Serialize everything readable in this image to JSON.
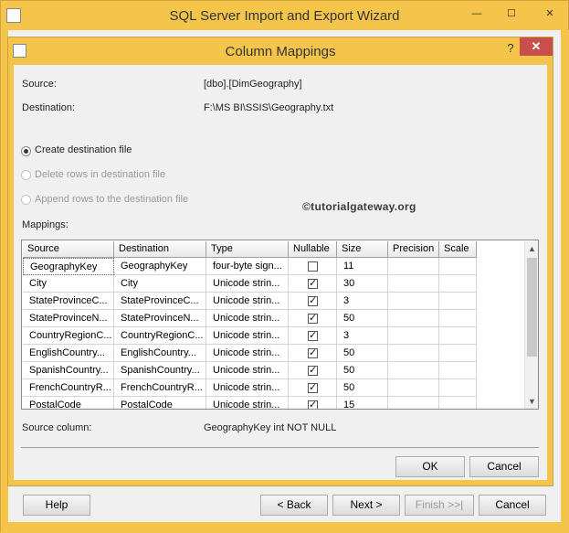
{
  "wizard": {
    "title": "SQL Server Import and Export Wizard",
    "controls": {
      "minimize": "—",
      "maximize": "☐",
      "close": "✕"
    },
    "buttons": {
      "help": "Help",
      "back": "< Back",
      "next": "Next >",
      "finish": "Finish >>|",
      "cancel": "Cancel"
    }
  },
  "dialog": {
    "title": "Column Mappings",
    "help_icon": "?",
    "close_icon": "✕",
    "source_label": "Source:",
    "source_value": "[dbo].[DimGeography]",
    "destination_label": "Destination:",
    "destination_value": "F:\\MS BI\\SSIS\\Geography.txt",
    "options": [
      {
        "label": "Create destination file",
        "selected": true,
        "enabled": true
      },
      {
        "label": "Delete rows in destination file",
        "selected": false,
        "enabled": false
      },
      {
        "label": "Append rows to the destination file",
        "selected": false,
        "enabled": false
      }
    ],
    "watermark": "©tutorialgateway.org",
    "mappings_label": "Mappings:",
    "columns": [
      "Source",
      "Destination",
      "Type",
      "Nullable",
      "Size",
      "Precision",
      "Scale"
    ],
    "rows": [
      {
        "source": "GeographyKey",
        "destination": "GeographyKey",
        "type": "four-byte sign...",
        "nullable": false,
        "size": "11"
      },
      {
        "source": "City",
        "destination": "City",
        "type": "Unicode strin...",
        "nullable": true,
        "size": "30"
      },
      {
        "source": "StateProvinceC...",
        "destination": "StateProvinceC...",
        "type": "Unicode strin...",
        "nullable": true,
        "size": "3"
      },
      {
        "source": "StateProvinceN...",
        "destination": "StateProvinceN...",
        "type": "Unicode strin...",
        "nullable": true,
        "size": "50"
      },
      {
        "source": "CountryRegionC...",
        "destination": "CountryRegionC...",
        "type": "Unicode strin...",
        "nullable": true,
        "size": "3"
      },
      {
        "source": "EnglishCountry...",
        "destination": "EnglishCountry...",
        "type": "Unicode strin...",
        "nullable": true,
        "size": "50"
      },
      {
        "source": "SpanishCountry...",
        "destination": "SpanishCountry...",
        "type": "Unicode strin...",
        "nullable": true,
        "size": "50"
      },
      {
        "source": "FrenchCountryR...",
        "destination": "FrenchCountryR...",
        "type": "Unicode strin...",
        "nullable": true,
        "size": "50"
      },
      {
        "source": "PostalCode",
        "destination": "PostalCode",
        "type": "Unicode strin...",
        "nullable": true,
        "size": "15"
      }
    ],
    "scroll": {
      "up": "▲",
      "down": "▼"
    },
    "source_column_label": "Source column:",
    "source_column_value": "GeographyKey int NOT NULL",
    "ok": "OK",
    "cancel": "Cancel"
  }
}
